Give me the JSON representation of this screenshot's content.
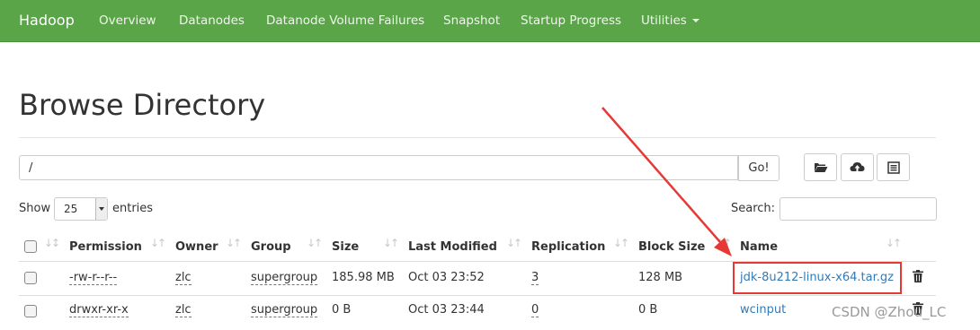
{
  "navbar": {
    "brand": "Hadoop",
    "items": [
      "Overview",
      "Datanodes",
      "Datanode Volume Failures",
      "Snapshot",
      "Startup Progress",
      "Utilities"
    ]
  },
  "page": {
    "title": "Browse Directory"
  },
  "path_bar": {
    "value": "/",
    "go_label": "Go!"
  },
  "toolbar": {
    "icons": [
      "folder-open-icon",
      "cloud-upload-icon",
      "list-icon"
    ]
  },
  "table_controls": {
    "show_label": "Show",
    "page_length": "25",
    "entries_label": "entries",
    "search_label": "Search:"
  },
  "table": {
    "columns": [
      "Permission",
      "Owner",
      "Group",
      "Size",
      "Last Modified",
      "Replication",
      "Block Size",
      "Name"
    ],
    "rows": [
      {
        "permission": "-rw-r--r--",
        "owner": "zlc",
        "group": "supergroup",
        "size": "185.98 MB",
        "modified": "Oct 03 23:52",
        "replication": "3",
        "block_size": "128 MB",
        "name": "jdk-8u212-linux-x64.tar.gz"
      },
      {
        "permission": "drwxr-xr-x",
        "owner": "zlc",
        "group": "supergroup",
        "size": "0 B",
        "modified": "Oct 03 23:44",
        "replication": "0",
        "block_size": "0 B",
        "name": "wcinput"
      }
    ]
  },
  "annotation": {
    "color": "#e53935"
  },
  "watermark": "CSDN @Zhou_LC",
  "colors": {
    "navbar": "#5aa548",
    "link": "#337ab7"
  }
}
